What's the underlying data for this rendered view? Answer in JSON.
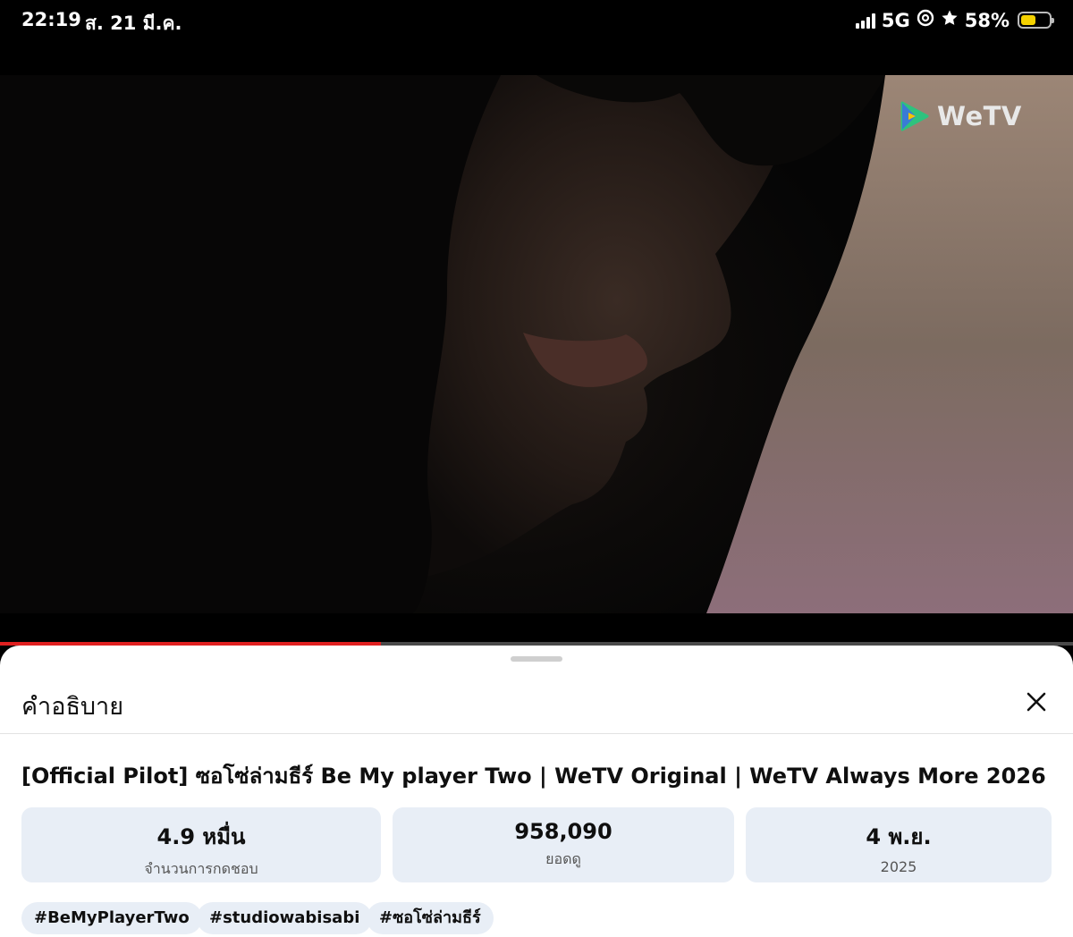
{
  "status_bar": {
    "time": "22:19",
    "date": "ส. 21 มี.ค.",
    "network": "5G",
    "battery_percent": "58%",
    "battery_level": 0.58,
    "icons": [
      "signal-icon",
      "at-icon",
      "star-icon",
      "battery-icon"
    ]
  },
  "video": {
    "logo_text": "WeTV",
    "progress_fraction": 0.355,
    "colors": {
      "progress": "#e02020",
      "logo_play": "#2ec27e"
    }
  },
  "description_sheet": {
    "title": "คำอธิบาย",
    "close_icon": "close-icon",
    "video_title": "[Official Pilot] ซอโซ่ล่ามธีร์ Be My player Two | WeTV Original | WeTV Always More 2026",
    "stats": [
      {
        "value": "4.9 หมื่น",
        "label": "จำนวนการกดชอบ"
      },
      {
        "value": "958,090",
        "label": "ยอดดู"
      },
      {
        "value": "4 พ.ย.",
        "label": "2025"
      }
    ],
    "hashtags": [
      "#BeMyPlayerTwo",
      "#studiowabisabi",
      "#ซอโซ่ล่ามธีร์"
    ]
  }
}
